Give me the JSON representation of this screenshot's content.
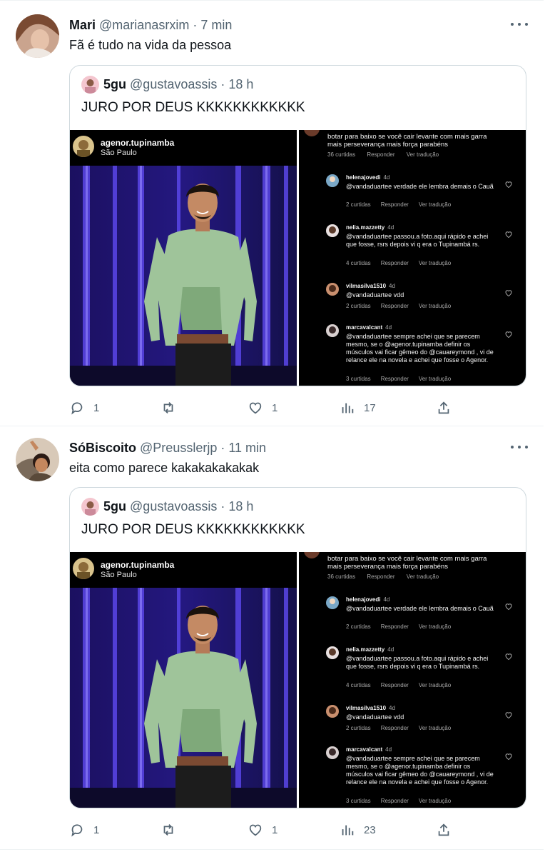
{
  "tweets": [
    {
      "name": "Mari",
      "handle": "@marianasrxim",
      "time": "· 7 min",
      "text": "Fã é tudo na vida da pessoa",
      "quote": {
        "name": "5gu",
        "handle": "@gustavoassis",
        "time": "· 18 h",
        "text": "JURO POR DEUS KKKKKKKKKKKK"
      },
      "stats": {
        "replies": "1",
        "retweets": "",
        "likes": "1",
        "views": "17"
      }
    },
    {
      "name": "SóBiscoito",
      "handle": "@Preusslerjp",
      "time": "· 11 min",
      "text": "eita como parece kakakakakakak",
      "quote": {
        "name": "5gu",
        "handle": "@gustavoassis",
        "time": "· 18 h",
        "text": "JURO POR DEUS KKKKKKKKKKKK"
      },
      "stats": {
        "replies": "1",
        "retweets": "",
        "likes": "1",
        "views": "23"
      }
    }
  ],
  "media": {
    "ig_user": "agenor.tupinamba",
    "ig_location": "São Paulo",
    "top_comment": "botar para baixo se você cair levante com mais garra mais perseverança mais força parabéns",
    "top_meta": {
      "likes": "36 curtidas",
      "reply": "Responder",
      "translate": "Ver tradução"
    },
    "comments": [
      {
        "user": "helenajovedi",
        "age": "4d",
        "text": "@vandaduartee verdade ele lembra demais o Cauã",
        "likes": "2 curtidas",
        "reply": "Responder",
        "translate": "Ver tradução"
      },
      {
        "user": "nelia.mazzetty",
        "age": "4d",
        "text": "@vandaduartee passou.a foto.aqui rápido e achei que  fosse, rsrs depois vi q era o Tupinambá rs.",
        "likes": "4 curtidas",
        "reply": "Responder",
        "translate": "Ver tradução"
      },
      {
        "user": "vilmasilva1510",
        "age": "4d",
        "text": "@vandaduartee vdd",
        "likes": "2 curtidas",
        "reply": "Responder",
        "translate": "Ver tradução"
      },
      {
        "user": "marcavalcant",
        "age": "4d",
        "text": "@vandaduartee sempre achei que se parecem mesmo, se o @agenor.tupinamba definir os músculos vai ficar gêmeo do @cauareymond , vi de relance ele na novela e achei que fosse o Agenor.",
        "likes": "3 curtidas",
        "reply": "Responder",
        "translate": "Ver tradução"
      }
    ]
  },
  "colors": {
    "accent": "#1d9bf0",
    "muted": "#536471",
    "border": "#cfd9de",
    "shirt": "#9fc49a",
    "curtain": "#4b3bd6"
  },
  "icons": [
    "more-icon",
    "reply-icon",
    "retweet-icon",
    "like-icon",
    "views-icon",
    "share-icon",
    "heart-icon"
  ]
}
